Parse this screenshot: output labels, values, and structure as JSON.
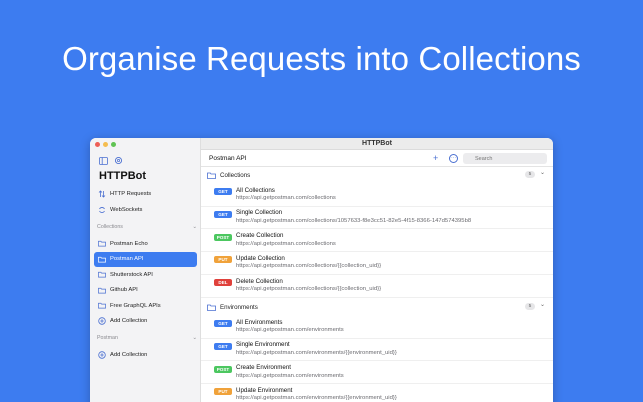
{
  "headline": "Organise Requests into Collections",
  "colors": {
    "accent": "#3d7cf0",
    "get": "#3d7cf0",
    "post": "#4cc760",
    "put": "#f0a23a",
    "del": "#e0413b"
  },
  "window": {
    "title": "HTTPBot",
    "traffic_lights": [
      "#ee5f57",
      "#f5bd4f",
      "#60c353"
    ]
  },
  "sidebar": {
    "app_title": "HTTPBot",
    "top_items": [
      {
        "label": "HTTP Requests",
        "icon": "arrows-icon"
      },
      {
        "label": "WebSockets",
        "icon": "sync-icon"
      }
    ],
    "collections_header": "Collections",
    "collections": [
      {
        "label": "Postman Echo",
        "icon": "folder-icon",
        "active": false
      },
      {
        "label": "Postman API",
        "icon": "folder-icon",
        "active": true
      },
      {
        "label": "Shutterstock API",
        "icon": "folder-icon",
        "active": false
      },
      {
        "label": "Github API",
        "icon": "folder-icon",
        "active": false
      },
      {
        "label": "Free GraphQL APIs",
        "icon": "folder-icon",
        "active": false
      },
      {
        "label": "Add Collection",
        "icon": "plus-circle-icon",
        "active": false
      }
    ],
    "postman_header": "Postman",
    "postman_add": "Add Collection"
  },
  "main": {
    "title": "Postman API",
    "search_placeholder": "Search",
    "groups": [
      {
        "label": "Collections",
        "count": "5",
        "requests": [
          {
            "method": "GET",
            "name": "All Collections",
            "url": "https://api.getpostman.com/collections"
          },
          {
            "method": "GET",
            "name": "Single Collection",
            "url": "https://api.getpostman.com/collections/1057633-f8e3cc51-82e5-4f15-8366-147d574395b8"
          },
          {
            "method": "POST",
            "name": "Create Collection",
            "url": "https://api.getpostman.com/collections"
          },
          {
            "method": "PUT",
            "name": "Update Collection",
            "url": "https://api.getpostman.com/collections/{{collection_uid}}"
          },
          {
            "method": "DEL",
            "name": "Delete Collection",
            "url": "https://api.getpostman.com/collections/{{collection_uid}}"
          }
        ]
      },
      {
        "label": "Environments",
        "count": "5",
        "requests": [
          {
            "method": "GET",
            "name": "All Environments",
            "url": "https://api.getpostman.com/environments"
          },
          {
            "method": "GET",
            "name": "Single Environment",
            "url": "https://api.getpostman.com/environments/{{environment_uid}}"
          },
          {
            "method": "POST",
            "name": "Create Environment",
            "url": "https://api.getpostman.com/environments"
          },
          {
            "method": "PUT",
            "name": "Update Environment",
            "url": "https://api.getpostman.com/environments/{{environment_uid}}"
          }
        ]
      }
    ]
  }
}
